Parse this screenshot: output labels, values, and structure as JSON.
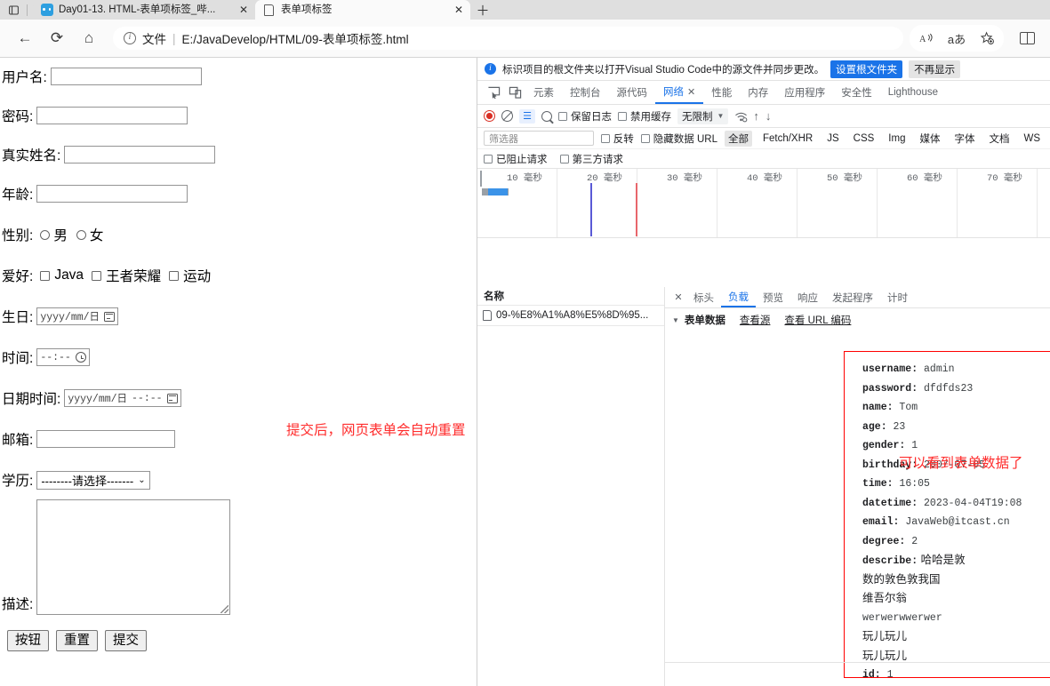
{
  "browser": {
    "tabs": [
      {
        "title": "Day01-13. HTML-表单项标签_哔...",
        "favicon": "vscode-icon",
        "active": false,
        "close_label": "✕"
      },
      {
        "title": "表单项标签",
        "favicon": "page-icon",
        "active": true,
        "close_label": "✕"
      }
    ],
    "new_tab_label": "＋",
    "nav": {
      "back": "←",
      "refresh": "⟳",
      "home": "⌂",
      "info_glyph": "i",
      "file_label": "文件",
      "separator": "|",
      "url": "E:/JavaDevelop/HTML/09-表单项标签.html"
    },
    "right_icons": [
      {
        "name": "read-aloud-icon",
        "glyph": "A"
      },
      {
        "name": "translate-icon",
        "glyph": "aあ"
      },
      {
        "name": "add-favorite-icon",
        "glyph": "☆"
      },
      {
        "name": "collections-icon",
        "glyph": ""
      }
    ]
  },
  "form": {
    "fields": [
      {
        "label": "用户名:",
        "type": "text",
        "value": ""
      },
      {
        "label": "密码:",
        "type": "password",
        "value": ""
      },
      {
        "label": "真实姓名:",
        "type": "text",
        "value": ""
      },
      {
        "label": "年龄:",
        "type": "text",
        "value": ""
      }
    ],
    "gender": {
      "label": "性别:",
      "options": [
        "男",
        "女"
      ]
    },
    "hobby": {
      "label": "爱好:",
      "options": [
        "Java",
        "王者荣耀",
        "运动"
      ]
    },
    "birthday": {
      "label": "生日:",
      "placeholder": "yyyy/mm/日"
    },
    "time": {
      "label": "时间:",
      "placeholder": "--:--"
    },
    "datetime": {
      "label": "日期时间:",
      "placeholder": "yyyy/mm/日",
      "time_placeholder": "--:--"
    },
    "email": {
      "label": "邮箱:",
      "value": ""
    },
    "degree": {
      "label": "学历:",
      "selected": "--------请选择-------",
      "chevron": "⌄"
    },
    "describe": {
      "label": "描述:",
      "value": ""
    },
    "buttons": [
      "按钮",
      "重置",
      "提交"
    ]
  },
  "annotations": {
    "left_note": "提交后，网页表单会自动重置",
    "right_note": "可以看到表单数据了",
    "color": "#ff2d2d"
  },
  "devtools": {
    "banner": {
      "text": "标识项目的根文件夹以打开Visual Studio Code中的源文件并同步更改。",
      "primary_button": "设置根文件夹",
      "secondary_button": "不再显示"
    },
    "panel_tabs": [
      {
        "label": "元素",
        "selected": false
      },
      {
        "label": "控制台",
        "selected": false
      },
      {
        "label": "源代码",
        "selected": false
      },
      {
        "label": "网络",
        "selected": true,
        "close": "✕"
      },
      {
        "label": "性能",
        "selected": false
      },
      {
        "label": "内存",
        "selected": false
      },
      {
        "label": "应用程序",
        "selected": false
      },
      {
        "label": "安全性",
        "selected": false
      },
      {
        "label": "Lighthouse",
        "selected": false
      }
    ],
    "toolbar": {
      "preserve_log": "保留日志",
      "disable_cache": "禁用缓存",
      "throttling": "无限制",
      "throttle_chevron": "▼"
    },
    "filter": {
      "placeholder": "筛选器",
      "invert": "反转",
      "hide_data_urls": "隐藏数据 URL",
      "types": [
        "全部",
        "Fetch/XHR",
        "JS",
        "CSS",
        "Img",
        "媒体",
        "字体",
        "文档",
        "WS"
      ],
      "selected_type": "全部",
      "blocked_requests": "已阻止请求",
      "third_party": "第三方请求"
    },
    "timeline": {
      "ticks": [
        "10 毫秒",
        "20 毫秒",
        "30 毫秒",
        "40 毫秒",
        "50 毫秒",
        "60 毫秒",
        "70 毫秒"
      ]
    },
    "requests": {
      "header": "名称",
      "rows": [
        {
          "name": "09-%E8%A1%A8%E5%8D%95..."
        }
      ]
    },
    "detail": {
      "close": "✕",
      "tabs": [
        {
          "label": "标头",
          "selected": false
        },
        {
          "label": "负载",
          "selected": true
        },
        {
          "label": "预览",
          "selected": false
        },
        {
          "label": "响应",
          "selected": false
        },
        {
          "label": "发起程序",
          "selected": false
        },
        {
          "label": "计时",
          "selected": false
        }
      ],
      "section": {
        "triangle": "▼",
        "title": "表单数据",
        "view_source": "查看源",
        "view_url_encoded": "查看 URL 编码"
      },
      "form_data": [
        {
          "key": "username:",
          "value": "admin"
        },
        {
          "key": "password:",
          "value": "dfdfds23"
        },
        {
          "key": "name:",
          "value": "Tom"
        },
        {
          "key": "age:",
          "value": "23"
        },
        {
          "key": "gender:",
          "value": "1"
        },
        {
          "key": "birthday:",
          "value": "2007-07-05"
        },
        {
          "key": "time:",
          "value": "16:05"
        },
        {
          "key": "datetime:",
          "value": "2023-04-04T19:08"
        },
        {
          "key": "email:",
          "value": "JavaWeb@itcast.cn"
        },
        {
          "key": "degree:",
          "value": "2"
        },
        {
          "key": "describe:",
          "value": "哈哈是敦"
        },
        {
          "key": "",
          "value": "数的敦色敦我国",
          "continuation": true,
          "cjk": true
        },
        {
          "key": "",
          "value": "维吾尔翁",
          "continuation": true,
          "cjk": true
        },
        {
          "key": "",
          "value": "werwerwwerwer",
          "continuation": true
        },
        {
          "key": "",
          "value": "玩儿玩儿",
          "continuation": true,
          "cjk": true
        },
        {
          "key": "",
          "value": "玩儿玩儿",
          "continuation": true,
          "cjk": true
        },
        {
          "key": "id:",
          "value": "1"
        }
      ]
    }
  }
}
